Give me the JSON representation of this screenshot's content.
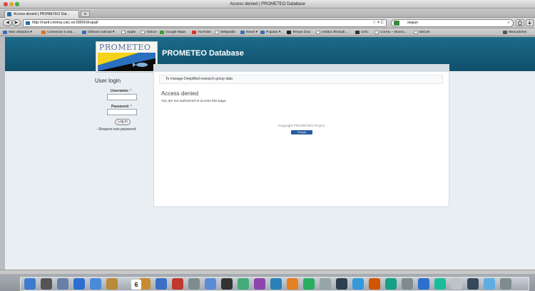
{
  "window": {
    "title": "Access denied | PROMETEO Database"
  },
  "tabs": [
    {
      "label": "Access denied | PROMETEO Dat..."
    }
  ],
  "navbar": {
    "url": "http://narit.cmima.csic.es:5800/drupal/",
    "search_value": "segun"
  },
  "bookmarks": [
    {
      "label": "Más visitados",
      "color": "#3c6fb4"
    },
    {
      "label": "Comenzar a usa...",
      "color": "#e0701a"
    },
    {
      "label": "Últimas noticias",
      "color": "#3c6fb4"
    },
    {
      "label": "Apple",
      "color": "#ffffff"
    },
    {
      "label": "Yahoo!",
      "color": "#ffffff"
    },
    {
      "label": "Google Maps",
      "color": "#3a9a3a"
    },
    {
      "label": "YouTube",
      "color": "#d9302c"
    },
    {
      "label": "Wikipedia",
      "color": "#ffffff"
    },
    {
      "label": "News",
      "color": "#3c6fb4"
    },
    {
      "label": "Popular",
      "color": "#3c6fb4"
    },
    {
      "label": "Temps d'ací",
      "color": "#222222"
    },
    {
      "label": "Institut d'Estudi...",
      "color": "#ffffff"
    },
    {
      "label": "UOC",
      "color": "#333333"
    },
    {
      "label": "Correu – Boxno...",
      "color": "#ffffff"
    },
    {
      "label": "BSCW",
      "color": "#ffffff"
    },
    {
      "label": "Marcadores",
      "color": "#555555"
    }
  ],
  "site": {
    "logo_text": "PROMETEO",
    "name": "PROMETEO Database",
    "mission": "To manage DeepMed research group data"
  },
  "login": {
    "title": "User login",
    "username_label": "Username:",
    "password_label": "Password:",
    "required_marker": "*",
    "button": "Log in",
    "new_password_link": "Request new password"
  },
  "main": {
    "title": "Access denied",
    "message": "You are not authorized to access this page."
  },
  "footer": {
    "copyright": "Copyright PROMETEO Project",
    "badge": "Drupal"
  },
  "dock": {
    "calendar_day": "6",
    "icon_colors": [
      "#3d7bd1",
      "#555",
      "#6a7fa8",
      "#2d6fd0",
      "#4a8ad8",
      "#bb8a3a",
      "#dddddd",
      "#c98b2f",
      "#3a6fc4",
      "#c0392b",
      "#7f8c8d",
      "#5b8bd6",
      "#333",
      "#4a7",
      "#8e44ad",
      "#2980b9",
      "#e67e22",
      "#27ae60",
      "#95a5a6",
      "#2c3e50",
      "#3498db",
      "#d35400",
      "#16a085",
      "#7f8c8d",
      "#2d6fd0",
      "#1abc9c",
      "#bdc3c7",
      "#34495e",
      "#5dade2",
      "#7f8c8d"
    ]
  }
}
